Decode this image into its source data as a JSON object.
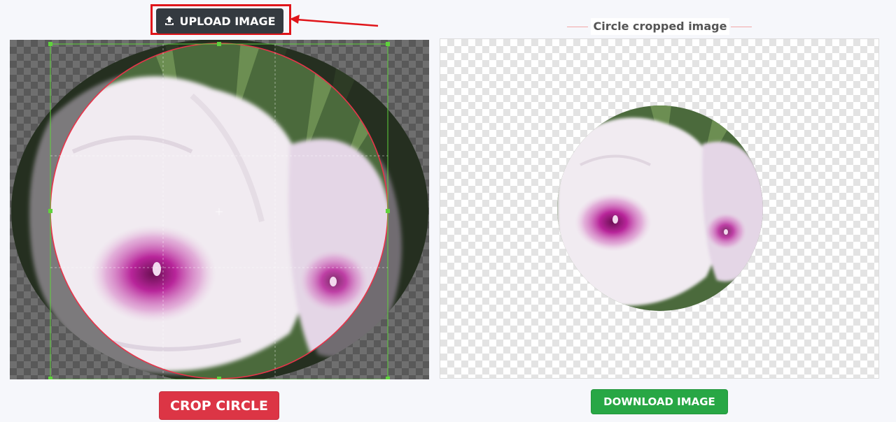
{
  "upload": {
    "label": "UPLOAD IMAGE",
    "icon": "upload-icon"
  },
  "editor": {
    "crop_shape": "circle",
    "accent": "#e8344a",
    "handle_color": "#5fd33c"
  },
  "result": {
    "title": "Circle cropped image"
  },
  "actions": {
    "crop_label": "CROP CIRCLE",
    "download_label": "DOWNLOAD IMAGE"
  },
  "colors": {
    "crop": "#dc3545",
    "download": "#28a745",
    "upload": "#343a40",
    "annotation": "#e0151a"
  }
}
